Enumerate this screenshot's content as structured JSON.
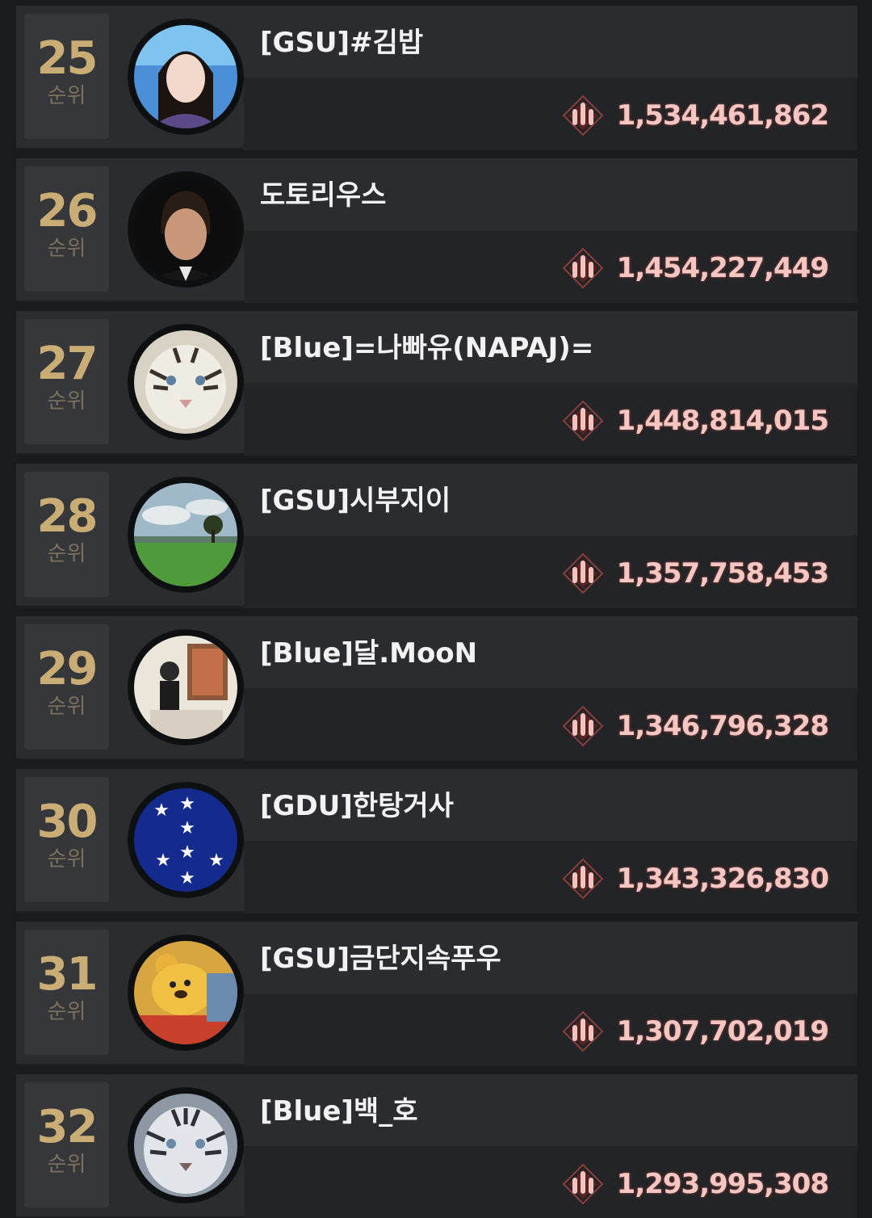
{
  "rank_label": "순위",
  "colors": {
    "background": "#1a1b1e",
    "row": "#2b2c30",
    "rank_number": "#c9ad74",
    "rank_label": "#7a705c",
    "score": "#f5c6c2",
    "icon_accent": "#d88a86"
  },
  "entries": [
    {
      "rank": "25",
      "name": "[GSU]#김밥",
      "score": "1,534,461,862",
      "avatar_icon": "portrait-icon"
    },
    {
      "rank": "26",
      "name": "도토리우스",
      "score": "1,454,227,449",
      "avatar_icon": "portrait-icon"
    },
    {
      "rank": "27",
      "name": "[Blue]=나빠유(NAPAJ)=",
      "score": "1,448,814,015",
      "avatar_icon": "white-tiger-icon"
    },
    {
      "rank": "28",
      "name": "[GSU]시부지이",
      "score": "1,357,758,453",
      "avatar_icon": "landscape-icon"
    },
    {
      "rank": "29",
      "name": "[Blue]달.MooN",
      "score": "1,346,796,328",
      "avatar_icon": "photo-icon"
    },
    {
      "rank": "30",
      "name": "[GDU]한탕거사",
      "score": "1,343,326,830",
      "avatar_icon": "star-flag-icon"
    },
    {
      "rank": "31",
      "name": "[GSU]금단지속푸우",
      "score": "1,307,702,019",
      "avatar_icon": "pooh-bear-icon"
    },
    {
      "rank": "32",
      "name": "[Blue]백_호",
      "score": "1,293,995,308",
      "avatar_icon": "white-tiger-icon"
    }
  ]
}
